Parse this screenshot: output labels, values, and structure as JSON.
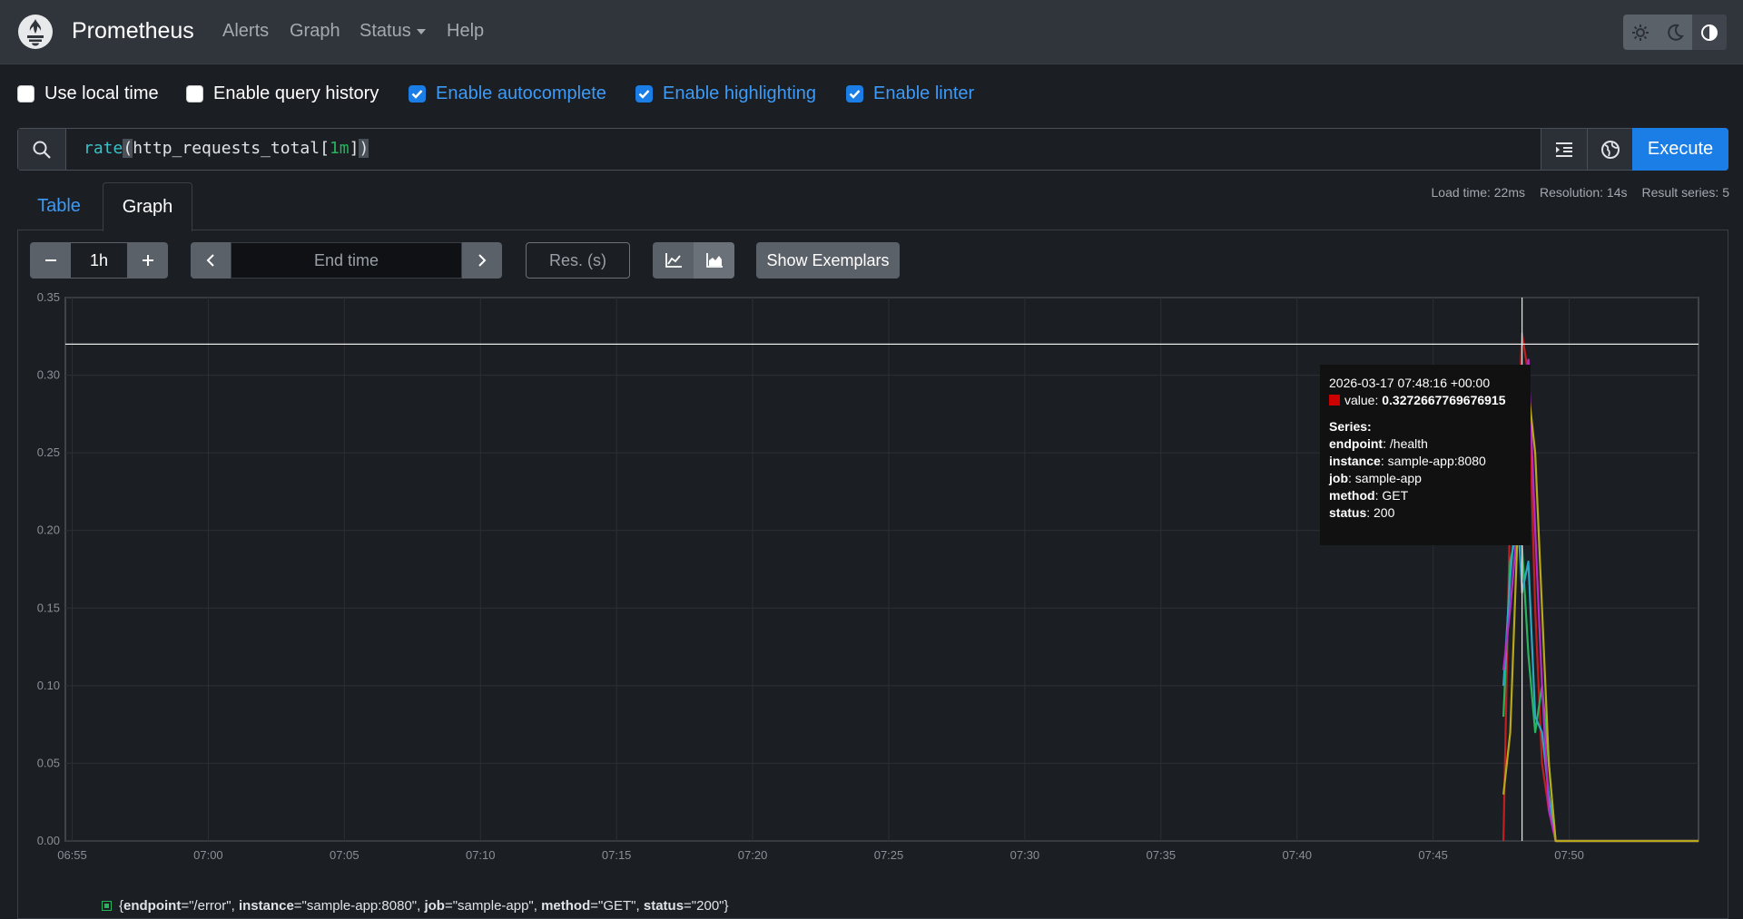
{
  "navbar": {
    "brand": "Prometheus",
    "links": {
      "alerts": "Alerts",
      "graph": "Graph",
      "status": "Status",
      "help": "Help"
    }
  },
  "options": {
    "local_time": "Use local time",
    "query_history": "Enable query history",
    "autocomplete": "Enable autocomplete",
    "highlighting": "Enable highlighting",
    "linter": "Enable linter"
  },
  "query": {
    "fn": "rate",
    "metric": "http_requests_total[",
    "range": "1m",
    "execute_label": "Execute"
  },
  "tabs": {
    "table": "Table",
    "graph": "Graph"
  },
  "stats": {
    "load_time": "Load time: 22ms",
    "resolution": "Resolution: 14s",
    "result_series": "Result series: 5"
  },
  "controls": {
    "range_value": "1h",
    "end_time_placeholder": "End time",
    "res_placeholder": "Res. (s)",
    "show_exemplars": "Show Exemplars"
  },
  "tooltip": {
    "timestamp": "2026-03-17 07:48:16 +00:00",
    "value_label": "value:",
    "value": "0.3272667769676915",
    "series_heading": "Series:",
    "labels": [
      {
        "key": "endpoint",
        "value": "/health"
      },
      {
        "key": "instance",
        "value": "sample-app:8080"
      },
      {
        "key": "job",
        "value": "sample-app"
      },
      {
        "key": "method",
        "value": "GET"
      },
      {
        "key": "status",
        "value": "200"
      }
    ]
  },
  "legend": {
    "prefix": "{",
    "k1": "endpoint",
    "v1": "=\"/error\", ",
    "k2": "instance",
    "v2": "=\"sample-app:8080\", ",
    "k3": "job",
    "v3": "=\"sample-app\", ",
    "k4": "method",
    "v4": "=\"GET\", ",
    "k5": "status",
    "v5": "=\"200\"}",
    "color": "#27b45c"
  },
  "chart_data": {
    "type": "line",
    "ylim": [
      0,
      0.35
    ],
    "yticks": [
      "0.00",
      "0.05",
      "0.10",
      "0.15",
      "0.20",
      "0.25",
      "0.30",
      "0.35"
    ],
    "xticks": [
      "06:55",
      "07:00",
      "07:05",
      "07:10",
      "07:15",
      "07:20",
      "07:25",
      "07:30",
      "07:35",
      "07:40",
      "07:45",
      "07:50"
    ],
    "xrange_minutes": [
      "06:54:45",
      "07:54:45"
    ],
    "hover_time": "07:48:16",
    "hover_value": 0.32,
    "series": [
      {
        "color": "#c21f1f",
        "points": [
          [
            "07:47:35",
            0
          ],
          [
            "07:47:50",
            0.22
          ],
          [
            "07:48:05",
            0.25
          ],
          [
            "07:48:16",
            0.327
          ],
          [
            "07:48:30",
            0.3
          ],
          [
            "07:48:45",
            0.15
          ],
          [
            "07:49:00",
            0.05
          ],
          [
            "07:49:15",
            0.02
          ],
          [
            "07:49:30",
            0
          ],
          [
            "07:54:45",
            0
          ]
        ]
      },
      {
        "color": "#27b45c",
        "points": [
          [
            "07:47:35",
            0.08
          ],
          [
            "07:47:50",
            0.18
          ],
          [
            "07:48:05",
            0.2
          ],
          [
            "07:48:16",
            0.19
          ],
          [
            "07:48:30",
            0.12
          ],
          [
            "07:48:45",
            0.07
          ],
          [
            "07:49:00",
            0.1
          ],
          [
            "07:49:15",
            0.05
          ],
          [
            "07:49:30",
            0
          ],
          [
            "07:54:45",
            0
          ]
        ]
      },
      {
        "color": "#2aa7c2",
        "points": [
          [
            "07:47:35",
            0.1
          ],
          [
            "07:47:50",
            0.17
          ],
          [
            "07:48:05",
            0.22
          ],
          [
            "07:48:16",
            0.16
          ],
          [
            "07:48:30",
            0.18
          ],
          [
            "07:48:45",
            0.08
          ],
          [
            "07:49:00",
            0.07
          ],
          [
            "07:49:15",
            0.03
          ],
          [
            "07:49:30",
            0
          ],
          [
            "07:54:45",
            0
          ]
        ]
      },
      {
        "color": "#b62bc9",
        "points": [
          [
            "07:47:35",
            0.11
          ],
          [
            "07:47:50",
            0.15
          ],
          [
            "07:48:05",
            0.2
          ],
          [
            "07:48:16",
            0.22
          ],
          [
            "07:48:30",
            0.31
          ],
          [
            "07:48:45",
            0.2
          ],
          [
            "07:49:00",
            0.1
          ],
          [
            "07:49:15",
            0.02
          ],
          [
            "07:49:30",
            0
          ],
          [
            "07:54:45",
            0
          ]
        ]
      },
      {
        "color": "#b8a81a",
        "points": [
          [
            "07:47:35",
            0.03
          ],
          [
            "07:47:50",
            0.07
          ],
          [
            "07:48:05",
            0.19
          ],
          [
            "07:48:16",
            0.24
          ],
          [
            "07:48:30",
            0.29
          ],
          [
            "07:48:45",
            0.25
          ],
          [
            "07:49:00",
            0.15
          ],
          [
            "07:49:15",
            0.05
          ],
          [
            "07:49:30",
            0
          ],
          [
            "07:54:45",
            0
          ]
        ]
      }
    ]
  }
}
